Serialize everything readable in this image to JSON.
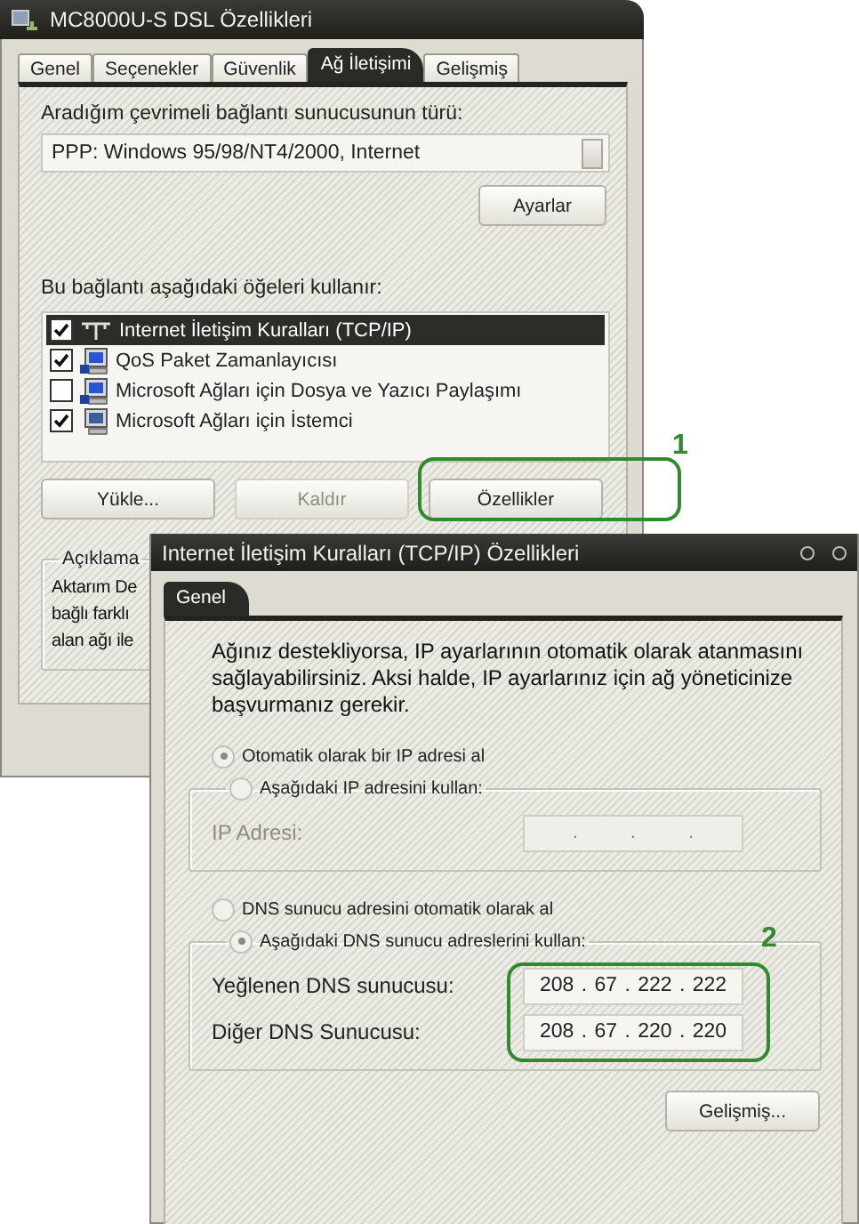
{
  "main_dialog": {
    "title": "MC8000U-S DSL Özellikleri",
    "tabs": [
      {
        "label": "Genel",
        "selected": false
      },
      {
        "label": "Seçenekler",
        "selected": false
      },
      {
        "label": "Güvenlik",
        "selected": false
      },
      {
        "label": "Ağ İletişimi",
        "selected": true
      },
      {
        "label": "Gelişmiş",
        "selected": false
      }
    ],
    "server_type_label": "Aradığım çevrimeli bağlantı sunucusunun türü:",
    "server_type": "PPP: Windows 95/98/NT4/2000, Internet",
    "settings_button": "Ayarlar",
    "components_label": "Bu bağlantı aşağıdaki öğeleri kullanır:",
    "components": [
      {
        "label": "Internet İletişim Kuralları (TCP/IP)",
        "kind": "protocol",
        "checked": true,
        "selected": true
      },
      {
        "label": "QoS Paket Zamanlayıcısı",
        "kind": "service",
        "checked": true,
        "selected": false
      },
      {
        "label": "Microsoft Ağları için Dosya ve Yazıcı Paylaşımı",
        "kind": "service",
        "checked": false,
        "selected": false
      },
      {
        "label": "Microsoft Ağları için İstemci",
        "kind": "client",
        "checked": true,
        "selected": false
      }
    ],
    "buttons": [
      {
        "label": "Yükle...",
        "disabled": false
      },
      {
        "label": "Kaldır",
        "disabled": true
      },
      {
        "label": "Özellikler",
        "disabled": false
      }
    ],
    "description": {
      "title": "Açıklama",
      "lines": [
        "Aktarım De",
        "bağlı farklı",
        "alan ağı ile"
      ]
    }
  },
  "tcpip_dialog": {
    "title": "Internet İletişim Kuralları (TCP/IP) Özellikleri",
    "tabs": [
      {
        "label": "Genel",
        "selected": true
      }
    ],
    "intro": "Ağınız destekliyorsa, IP ayarlarının otomatik olarak atanmasını sağlayabilirsiniz. Aksi halde, IP ayarlarınız için ağ yöneticinize başvurmanız gerekir.",
    "ip_options": [
      {
        "label": "Otomatik olarak bir IP adresi al",
        "selected": true
      },
      {
        "label": "Aşağıdaki IP adresini kullan:",
        "selected": false
      }
    ],
    "ip_fields": [
      {
        "label": "IP Adresi:",
        "disabled": true
      }
    ],
    "dns_options": [
      {
        "label": "DNS sunucu adresini otomatik olarak al",
        "selected": false
      },
      {
        "label": "Aşağıdaki DNS sunucu adreslerini kullan:",
        "selected": true
      }
    ],
    "dns_fields": [
      {
        "label": "Yeğlenen DNS sunucusu:",
        "disabled": false,
        "octets": [
          "208",
          "67",
          "222",
          "222"
        ]
      },
      {
        "label": "Diğer DNS Sunucusu:",
        "disabled": false,
        "octets": [
          "208",
          "67",
          "220",
          "220"
        ]
      }
    ],
    "octet_separator": ".",
    "advanced_button": "Gelişmiş..."
  },
  "annotations": [
    {
      "label": "1"
    },
    {
      "label": "2"
    }
  ]
}
